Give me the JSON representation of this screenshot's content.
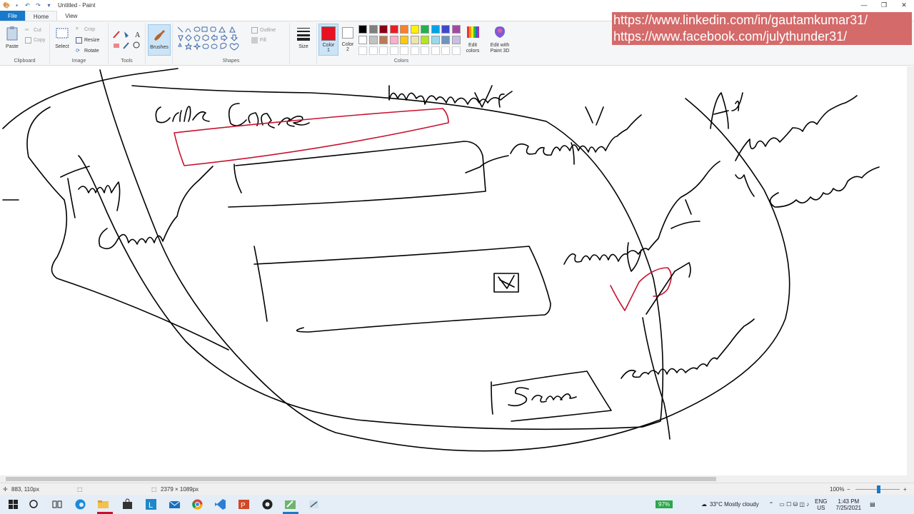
{
  "window": {
    "title": "Untitled - Paint",
    "controls": [
      "—",
      "❐",
      "✕"
    ]
  },
  "tabs": [
    {
      "label": "File"
    },
    {
      "label": "Home"
    },
    {
      "label": "View"
    }
  ],
  "ribbon": {
    "clipboard": {
      "paste": "Paste",
      "cut": "Cut",
      "copy": "Copy",
      "group": "Clipboard"
    },
    "image": {
      "select": "Select",
      "crop": "Crop",
      "resize": "Resize",
      "rotate": "Rotate",
      "group": "Image"
    },
    "tools": {
      "group": "Tools"
    },
    "brushes": {
      "label": "Brushes"
    },
    "shapes": {
      "outline": "Outline",
      "fill": "Fill",
      "group": "Shapes"
    },
    "size": {
      "label": "Size"
    },
    "color1": {
      "label": "Color",
      "sub": "1",
      "value": "#e81123"
    },
    "color2": {
      "label": "Color",
      "sub": "2",
      "value": "#ffffff"
    },
    "palette_row1": [
      "#000000",
      "#7f7f7f",
      "#880015",
      "#ed1c24",
      "#ff7f27",
      "#fff200",
      "#22b14c",
      "#00a2e8",
      "#3f48cc",
      "#a349a4"
    ],
    "palette_row2": [
      "#ffffff",
      "#c3c3c3",
      "#b97a57",
      "#ffaec9",
      "#ffc90e",
      "#efe4b0",
      "#b5e61d",
      "#99d9ea",
      "#7092be",
      "#c8bfe7"
    ],
    "edit_colors": "Edit colors",
    "paint3d": "Edit with Paint 3D",
    "colors_group": "Colors"
  },
  "overlay": {
    "linkedin": "https://www.linkedin.com/in/gautamkumar31/",
    "facebook": "https://www.facebook.com/julythunder31/"
  },
  "statusbar": {
    "cursor_pos": "883, 110px",
    "canvas_size": "2379 × 1089px",
    "zoom": "100%"
  },
  "taskbar": {
    "battery": "97%",
    "weather": "33°C  Mostly cloudy",
    "lang1": "ENG",
    "lang2": "US",
    "time": "1:43 PM",
    "date": "7/25/2021"
  },
  "colors": {
    "ribbon_bg": "#f5f6f7",
    "file_tab": "#1979ca",
    "ink_black": "#000000",
    "ink_red": "#c8102e",
    "overlay_bg": "#d46a6a"
  }
}
